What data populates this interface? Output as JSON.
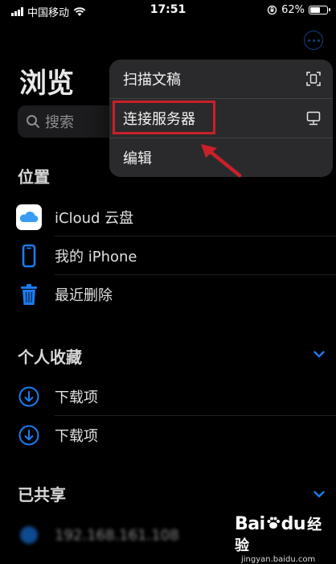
{
  "status_bar": {
    "carrier": "中国移动",
    "time": "17:51",
    "battery_percent": "62%",
    "battery_level": 0.62
  },
  "browse": {
    "title": "浏览",
    "search_placeholder": "搜索"
  },
  "locations": {
    "title": "位置",
    "items": [
      {
        "label": "iCloud 云盘",
        "icon": "icloud-icon"
      },
      {
        "label": "我的 iPhone",
        "icon": "iphone-icon"
      },
      {
        "label": "最近删除",
        "icon": "trash-icon"
      }
    ]
  },
  "favorites": {
    "title": "个人收藏",
    "items": [
      {
        "label": "下载项",
        "icon": "download-icon"
      },
      {
        "label": "下载项",
        "icon": "download-icon"
      }
    ]
  },
  "shared": {
    "title": "已共享",
    "items": [
      {
        "label": "192.168.161.108",
        "icon": "server-globe-icon"
      }
    ]
  },
  "context_menu": {
    "items": [
      {
        "label": "扫描文稿",
        "icon": "scan-document-icon"
      },
      {
        "label": "连接服务器",
        "icon": "server-monitor-icon",
        "highlighted": true
      },
      {
        "label": "编辑"
      }
    ]
  },
  "watermark": {
    "logo_text": "Bai",
    "logo_text_2": "du",
    "logo_suffix": "经验",
    "url": "jingyan.baidu.com"
  },
  "colors": {
    "accent": "#1a7cf0",
    "highlight_box": "#c9202a",
    "menu_bg": "#2a2a2c",
    "background": "#000000"
  }
}
